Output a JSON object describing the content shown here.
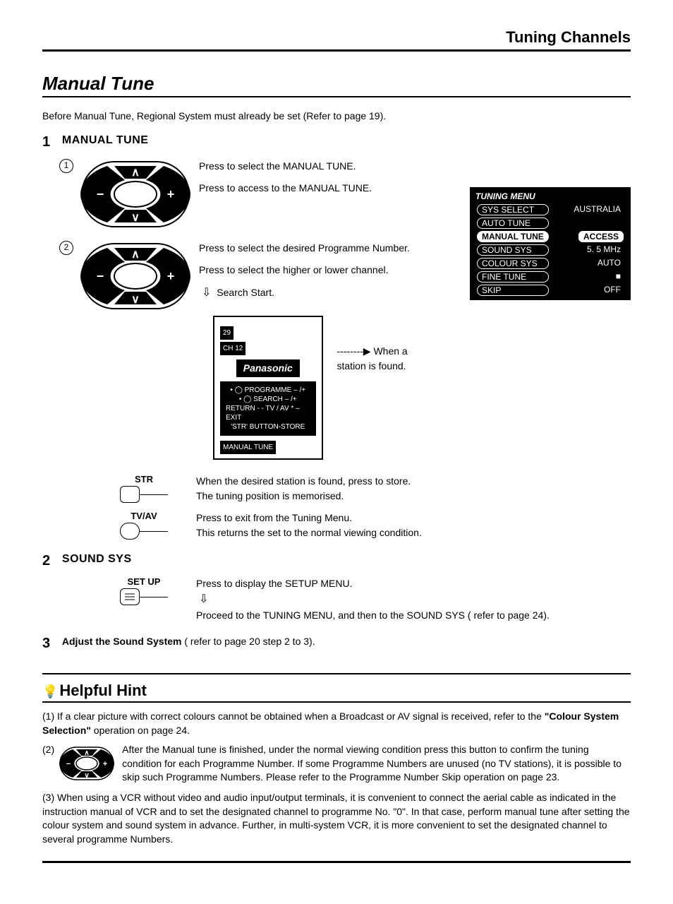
{
  "header": "Tuning Channels",
  "title": "Manual Tune",
  "intro": "Before Manual Tune, Regional System must already be set (Refer to page 19).",
  "step1": {
    "num": "1",
    "head": "MANUAL TUNE",
    "c1_a": "Press to select the MANUAL TUNE.",
    "c1_b": "Press to access to the MANUAL TUNE.",
    "c2_a": "Press to select the desired Programme Number.",
    "c2_b": "Press to select the  higher or lower channel.",
    "search": "Search Start.",
    "found": "When a station is found.",
    "str_label": "STR",
    "str_a": "When the desired station is found, press to store.",
    "str_b": "The tuning position is memorised.",
    "tvav_label": "TV/AV",
    "tvav_a": "Press to exit from the Tuning Menu.",
    "tvav_b": "This returns the set to the normal viewing condition."
  },
  "menu": {
    "title": "TUNING MENU",
    "rows": [
      {
        "l": "SYS SELECT",
        "r": "AUSTRALIA"
      },
      {
        "l": "AUTO TUNE",
        "r": ""
      },
      {
        "l": "MANUAL TUNE",
        "r": "ACCESS",
        "sel": true
      },
      {
        "l": "SOUND SYS",
        "r": "5. 5 MHz"
      },
      {
        "l": "COLOUR SYS",
        "r": "AUTO"
      },
      {
        "l": "FINE TUNE",
        "r": "■"
      },
      {
        "l": "SKIP",
        "r": "OFF"
      }
    ]
  },
  "osd": {
    "ch_top": "29",
    "ch": "CH 12",
    "brand": "Panasonic",
    "l1": "PROGRAMME  – /+",
    "l2": "SEARCH  – /+",
    "l3": "RETURN - - TV / AV * – EXIT",
    "l4": "'STR' BUTTON-STORE",
    "tag": "MANUAL TUNE"
  },
  "step2": {
    "num": "2",
    "head": "SOUND SYS",
    "setup_label": "SET UP",
    "a": "Press to display the SETUP MENU.",
    "b": "Proceed to the TUNING MENU, and then to the SOUND SYS ( refer to page 24)."
  },
  "step3": {
    "num": "3",
    "bold": "Adjust the Sound System",
    "rest": " ( refer to page 20 step 2 to 3)."
  },
  "hint": {
    "title": "Helpful Hint",
    "h1a": "(1) If a clear picture with correct colours cannot be obtained when a Broadcast or AV signal is received, refer to the ",
    "h1b": "\"Colour System Selection\"",
    "h1c": " operation on page 24.",
    "h2n": "(2)",
    "h2": "After the Manual tune is finished, under the normal viewing condition press this button to confirm the tuning condition for each Programme Number. If some Programme Numbers are unused (no TV stations), it is possible to skip such Programme Numbers. Please refer to the Programme Number Skip operation on page 23.",
    "h3": "(3) When using a VCR without video and audio input/output terminals, it is convenient to connect the aerial cable as indicated in the instruction manual of VCR and to set the designated channel to programme No. \"0\". In that case, perform manual tune after setting the colour system and sound system in advance. Further, in multi-system VCR, it is more convenient to set the designated channel to several programme Numbers."
  }
}
